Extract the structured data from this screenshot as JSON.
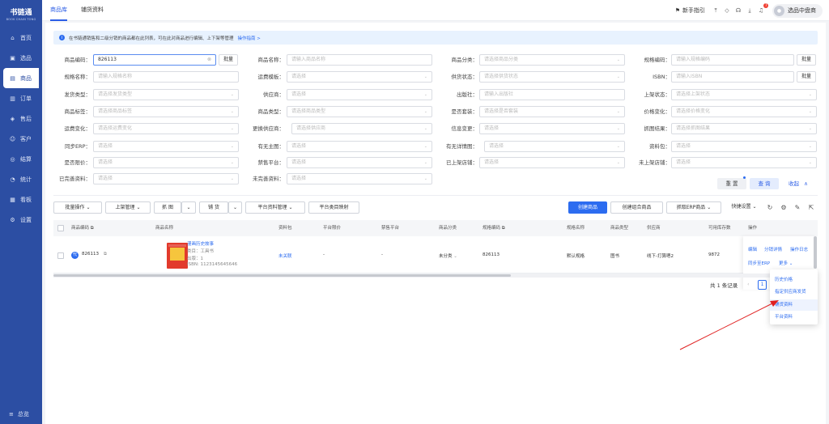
{
  "app": {
    "logo_title": "书链通",
    "logo_sub": "BOOK CHAIN TONG"
  },
  "sidebar": {
    "items": [
      {
        "label": "首页",
        "icon": "home-icon",
        "glyph": "⌂"
      },
      {
        "label": "选品",
        "icon": "select-icon",
        "glyph": "▣"
      },
      {
        "label": "商品",
        "icon": "goods-icon",
        "glyph": "▤"
      },
      {
        "label": "订单",
        "icon": "order-icon",
        "glyph": "▥"
      },
      {
        "label": "售后",
        "icon": "aftersale-icon",
        "glyph": "◈"
      },
      {
        "label": "客户",
        "icon": "customer-icon",
        "glyph": "☺"
      },
      {
        "label": "结算",
        "icon": "settle-icon",
        "glyph": "◎"
      },
      {
        "label": "统计",
        "icon": "stats-icon",
        "glyph": "◔"
      },
      {
        "label": "看板",
        "icon": "board-icon",
        "glyph": "▦"
      },
      {
        "label": "设置",
        "icon": "settings-icon",
        "glyph": "⚙"
      }
    ],
    "active_index": 2,
    "collapse_label": "总览"
  },
  "topbar": {
    "tabs": [
      "商品库",
      "铺货资料"
    ],
    "guide_label": "新手指引",
    "notification_count": "7",
    "user_name": "选品中盘商"
  },
  "notice": {
    "text": "在书链通销售和二级分销的商品都在此列表，可在此对商品进行编辑、上下架等管理",
    "link": "操作指南 >"
  },
  "filters": {
    "labels": {
      "code": "商品编码：",
      "name": "商品名称：",
      "category": "商品分类：",
      "spec_code": "规格编码：",
      "spec_name": "规格名称：",
      "freight_tpl": "运费模板：",
      "supply_status": "供货状态：",
      "isbn": "ISBN：",
      "ship_type": "发货类型：",
      "supplier": "供应商：",
      "publisher": "出版社：",
      "shelf_status": "上架状态：",
      "tag": "商品标签：",
      "goods_type": "商品类型：",
      "is_bundle": "是否套装：",
      "price_change": "价格变化：",
      "freight_change": "运费变化：",
      "change_supplier": "更换供应商：",
      "info_change": "信息变更：",
      "capture_result": "抓图结果：",
      "sync_erp": "同步ERP：",
      "has_main_img": "有无主图：",
      "has_detail_img": "有无详情图：",
      "material_pkg": "资料包：",
      "limit_price": "是否限价：",
      "forbidden_platform": "禁售平台：",
      "listed_shop": "已上架店铺：",
      "unlisted_shop": "未上架店铺：",
      "complete_info": "已完善资料：",
      "incomplete_info": "未完善资料："
    },
    "code_value": "826113",
    "batch_label": "批量",
    "placeholders": {
      "name": "请输入商品名称",
      "category": "请选择商品分类",
      "spec_code": "请输入规格编码",
      "spec_name": "请输入规格名称",
      "select": "请选择",
      "supply_status": "请选择供货状态",
      "isbn": "请输入ISBN",
      "ship_type": "请选择发货类型",
      "publisher": "请输入出版社",
      "shelf_status": "请选择上架状态",
      "tag": "请选择商品标签",
      "goods_type": "请选择商品类型",
      "is_bundle": "请选择是否套装",
      "price_change": "请选择价格变化",
      "freight_change": "请选择运费变化",
      "change_supplier": "请选择供应商",
      "capture_result": "请选择抓图结果"
    },
    "reset_label": "重 置",
    "query_label": "查 询",
    "collapse_label": "收起"
  },
  "toolbar": {
    "batch_ops": "批量操作",
    "shelf_mgmt": "上架管理",
    "capture": "抓 图",
    "distribute": "铺 货",
    "platform_mgmt": "平台资料管理",
    "platform_map": "平台类目映射",
    "create_goods": "创建商品",
    "create_bundle": "创建组合商品",
    "fetch_erp": "抓取ERP商品",
    "quick_settings": "快捷设置"
  },
  "table": {
    "headers": [
      "商品编码",
      "商品名称",
      "资料包",
      "平台限价",
      "禁售平台",
      "商品分类",
      "规格编码",
      "规格名称",
      "商品类型",
      "供应商",
      "可用库存数",
      "操作"
    ],
    "rows": [
      {
        "badge": "代",
        "code": "826113",
        "title": "漫画历史故事",
        "category_line": "类目：工具书",
        "edition_line": "出版：1",
        "isbn_line": "ISBN: 1123145645646",
        "material": "未关联",
        "limit_price": "-",
        "forbidden": "-",
        "category": "未分类",
        "spec_code": "826113",
        "spec_name": "默认规格",
        "goods_type": "图书",
        "supplier": "线下-打算嗯2",
        "stock": "9872",
        "ops": {
          "edit": "编辑",
          "dist_detail": "分销详情",
          "log": "操作日志",
          "sync_erp": "同步至ERP",
          "more": "更多"
        }
      }
    ]
  },
  "pagination": {
    "total": "共 1 条记录",
    "current": "1"
  },
  "more_menu": {
    "items": [
      "历史价格",
      "指定供应商发货",
      "铺货资料",
      "平台资料"
    ],
    "hover_index": 2
  },
  "colors": {
    "sidebar": "#2c4ea3",
    "primary": "#2c6cf0",
    "arrow": "#e02020"
  }
}
